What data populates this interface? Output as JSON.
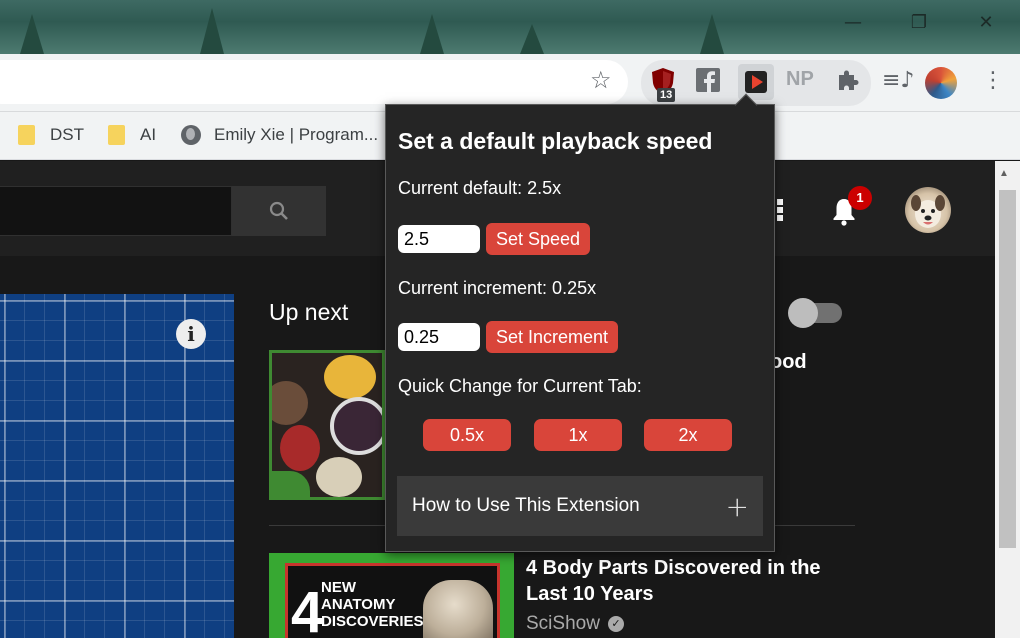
{
  "window": {
    "minimize_glyph": "—",
    "restore_glyph": "❐",
    "close_glyph": "✕"
  },
  "toolbar": {
    "extensions": [
      {
        "icon": "ublock-shield-icon",
        "badge": "13"
      },
      {
        "icon": "facebook-icon"
      },
      {
        "icon": "playback-speed-extension-icon"
      },
      {
        "icon": "np-extension-icon",
        "label": "NP"
      },
      {
        "icon": "puzzle-extensions-icon"
      }
    ],
    "media_icon_glyph": "≡♪",
    "menu_glyph": "⋮",
    "star_glyph": "☆"
  },
  "bookmarks": [
    {
      "icon": "folder-icon",
      "label": "DST"
    },
    {
      "icon": "folder-icon",
      "label": "AI"
    },
    {
      "icon": "globe-icon",
      "label": "Emily Xie | Program..."
    }
  ],
  "youtube": {
    "notification_count": "1",
    "up_next_label": "Up next",
    "partial_video_title": "ood",
    "video2": {
      "thumbnail_number": "4",
      "thumbnail_text": "NEW\nANATOMY\nDISCOVERIES",
      "title": "4 Body Parts Discovered in the Last 10 Years",
      "channel": "SciShow"
    },
    "info_glyph": "i"
  },
  "popup": {
    "title": "Set a default playback speed",
    "current_default": "Current default: 2.5x",
    "speed_input_value": "2.5",
    "set_speed_label": "Set Speed",
    "current_increment": "Current increment: 0.25x",
    "increment_input_value": "0.25",
    "set_increment_label": "Set Increment",
    "quick_change_label": "Quick Change for Current Tab:",
    "quick_buttons": [
      "0.5x",
      "1x",
      "2x"
    ],
    "howto_label": "How to Use This Extension",
    "howto_expand_glyph": "+"
  },
  "colors": {
    "accent_button": "#d9453a",
    "popup_bg": "#252525",
    "youtube_bg": "#181818"
  }
}
